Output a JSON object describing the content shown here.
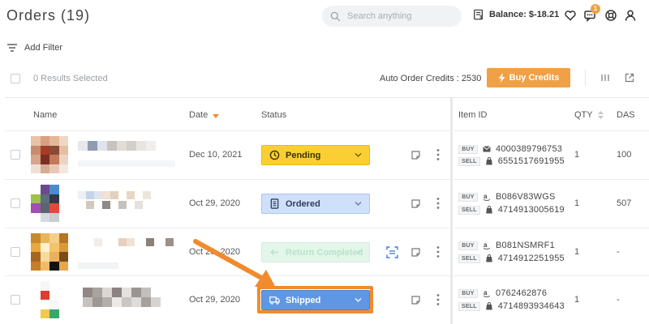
{
  "header": {
    "title": "Orders (19)",
    "search_placeholder": "Search anything",
    "balance": "Balance: $-18.21",
    "notification_count": "1",
    "icons": [
      "search-icon",
      "wallet-icon",
      "heart-icon",
      "chat-icon",
      "support-icon",
      "user-icon"
    ]
  },
  "filter": {
    "label": "Add Filter"
  },
  "toolbar": {
    "results_selected": "0 Results Selected",
    "credits": "Auto Order Credits : 2530",
    "buy_label": "Buy Credits"
  },
  "table": {
    "columns": {
      "name": "Name",
      "date": "Date",
      "status": "Status",
      "item_id": "Item ID",
      "qty": "QTY",
      "das": "DAS"
    },
    "rows": [
      {
        "date": "Dec 10, 2021",
        "status": "Pending",
        "buy_tag": "BUY",
        "buy_id": "4000389796753",
        "buy_icon": "mail-icon",
        "sell_tag": "SELL",
        "sell_id": "6551517691955",
        "sell_icon": "shopify-icon",
        "qty": "1",
        "das": "100"
      },
      {
        "date": "Oct 29, 2020",
        "status": "Ordered",
        "buy_tag": "BUY",
        "buy_id": "B086V83WGS",
        "buy_icon": "amazon-icon",
        "sell_tag": "SELL",
        "sell_id": "4714913005619",
        "sell_icon": "shopify-icon",
        "qty": "1",
        "das": "507"
      },
      {
        "date": "Oct 29, 2020",
        "status": "Return Completed",
        "buy_tag": "BUY",
        "buy_id": "B081NSMRF1",
        "buy_icon": "amazon-icon",
        "sell_tag": "SELL",
        "sell_id": "4714912251955",
        "sell_icon": "shopify-icon",
        "qty": "1",
        "das": "-"
      },
      {
        "date": "Oct 29, 2020",
        "status": "Shipped",
        "buy_tag": "BUY",
        "buy_id": "0762462876",
        "buy_icon": "amazon-icon",
        "sell_tag": "SELL",
        "sell_id": "4714893934643",
        "sell_icon": "shopify-icon",
        "qty": "1",
        "das": "-"
      }
    ]
  },
  "colors": {
    "accent_orange": "#f0a045",
    "pending": "#fbcf34",
    "ordered": "#cfe0fb",
    "return_completed": "#e3f6ea",
    "shipped": "#5f97e5",
    "annotation": "#f08b2e"
  }
}
